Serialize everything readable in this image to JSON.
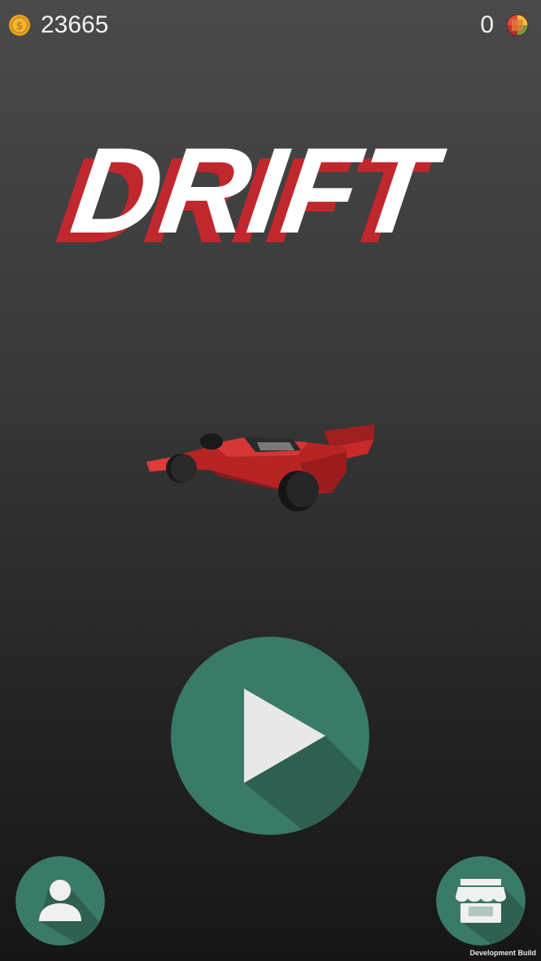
{
  "hud": {
    "coins": "23665",
    "gems": "0"
  },
  "logo": {
    "title": "DRIFT",
    "fill_color": "#ffffff",
    "shadow_color": "#c0282d"
  },
  "buttons": {
    "accent_color": "#3a7a68",
    "shadow_color": "#2f6052",
    "play_icon": "play-triangle",
    "profile_icon": "person",
    "shop_icon": "storefront"
  },
  "footer": {
    "build_label": "Development Build"
  }
}
